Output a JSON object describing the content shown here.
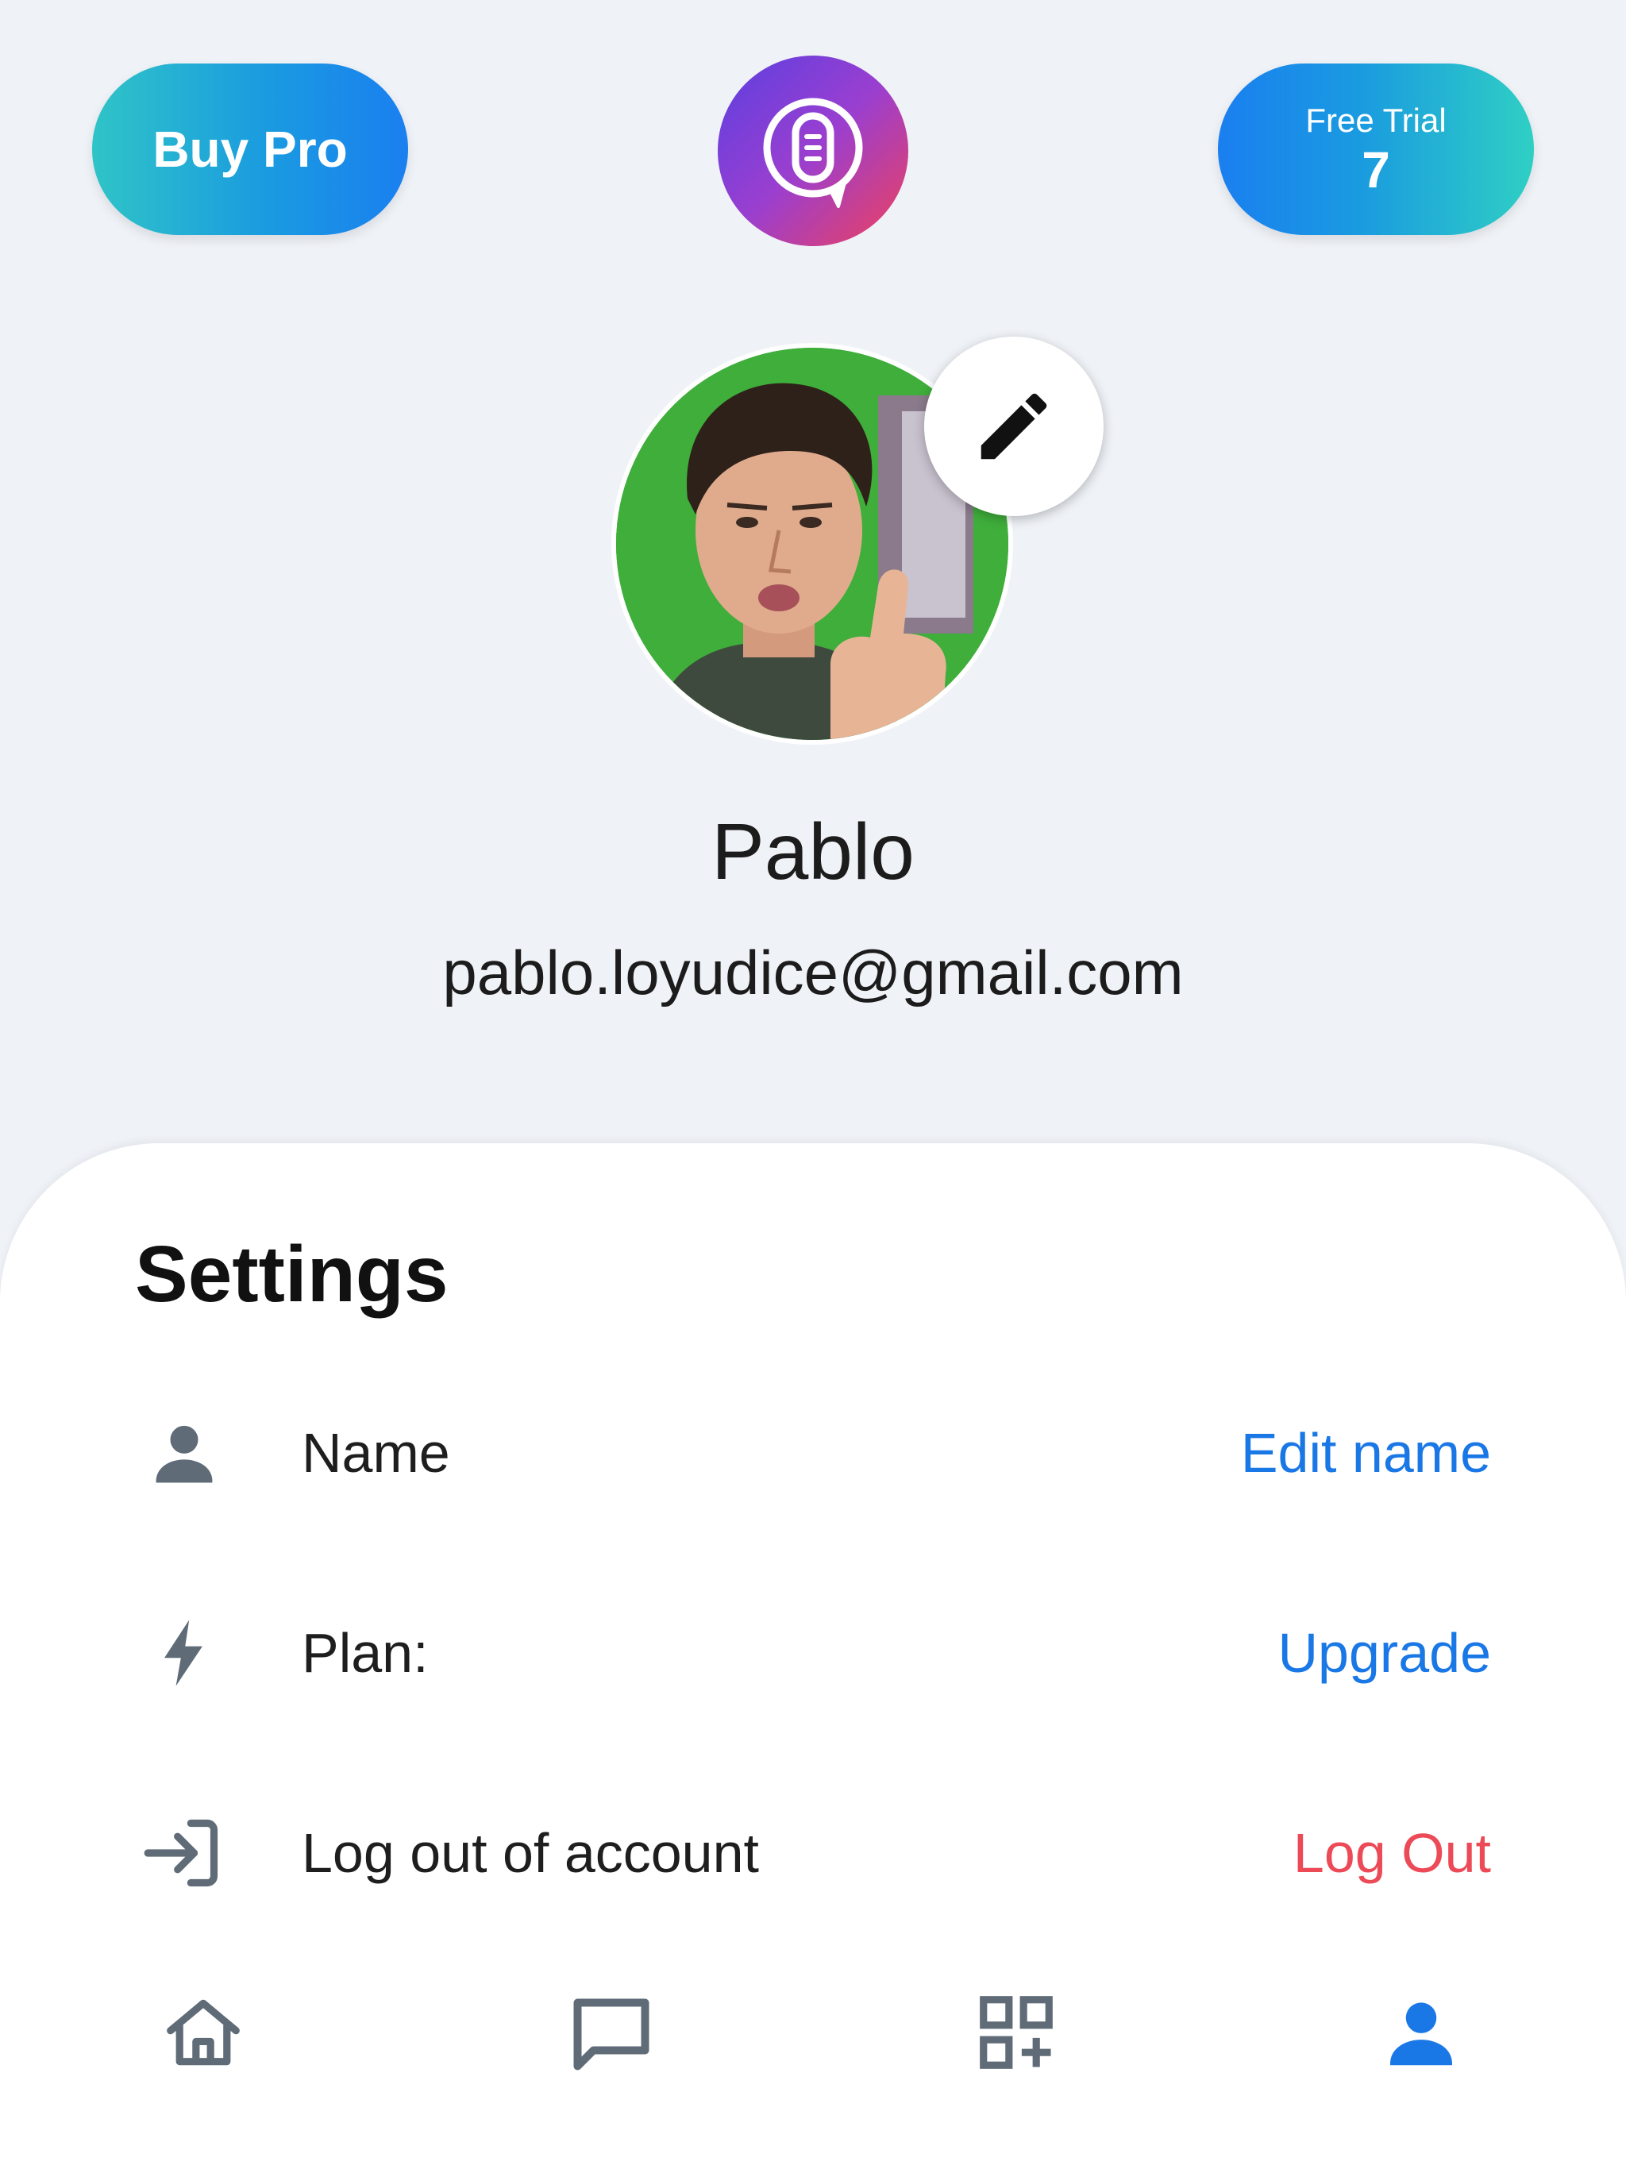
{
  "top_bar": {
    "buy_pro_label": "Buy Pro",
    "free_trial_label": "Free Trial",
    "free_trial_count": "7",
    "logo_icon": "microphone-chat-icon"
  },
  "profile": {
    "name": "Pablo",
    "email": "pablo.loyudice@gmail.com",
    "edit_icon": "pencil-icon"
  },
  "settings": {
    "title": "Settings",
    "rows": [
      {
        "icon": "person-icon",
        "label": "Name",
        "action": "Edit name",
        "action_color": "#1a78e6"
      },
      {
        "icon": "lightning-icon",
        "label": "Plan:",
        "action": "Upgrade",
        "action_color": "#1a78e6"
      },
      {
        "icon": "login-arrow-icon",
        "label": "Log out of account",
        "action": "Log Out",
        "action_color": "#ec4a57"
      }
    ]
  },
  "bottom_nav": {
    "items": [
      {
        "icon": "home-icon",
        "active": false
      },
      {
        "icon": "chat-bubble-icon",
        "active": false
      },
      {
        "icon": "add-widget-icon",
        "active": false
      },
      {
        "icon": "profile-icon",
        "active": true
      }
    ],
    "active_color": "#1a78e6",
    "inactive_color": "#5f6b76"
  },
  "colors": {
    "background": "#eff2f7",
    "accent": "#1a78e6",
    "danger": "#ec4a57"
  }
}
